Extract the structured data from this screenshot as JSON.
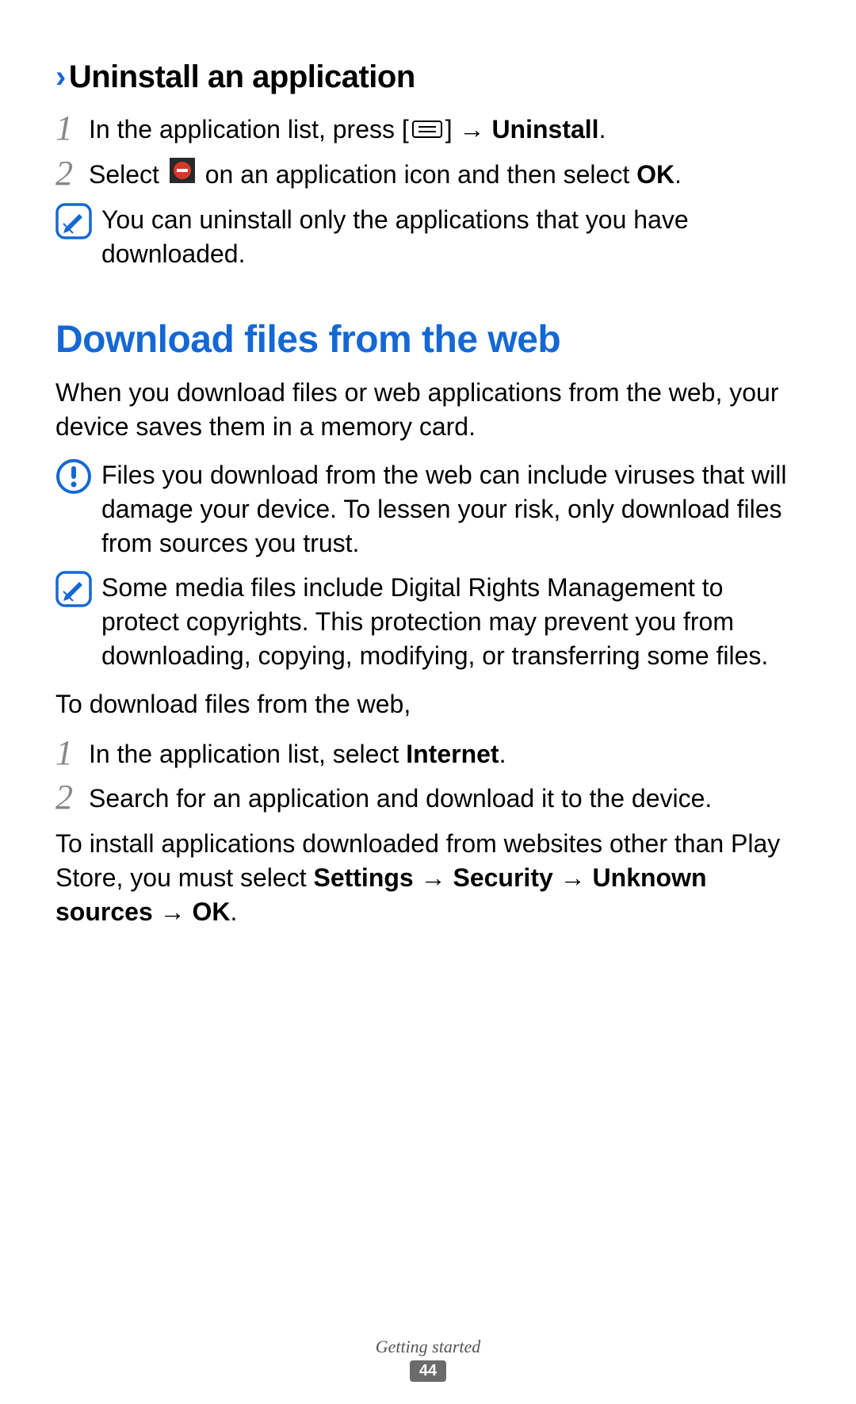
{
  "subsection": {
    "chevron": "›",
    "title": "Uninstall an application"
  },
  "steps1": [
    {
      "num": "1",
      "pre": "In the application list, press [",
      "post": "] → ",
      "bold": "Uninstall",
      "tail": "."
    },
    {
      "num": "2",
      "pre": "Select ",
      "post": " on an application icon and then select ",
      "bold": "OK",
      "tail": "."
    }
  ],
  "note1": "You can uninstall only the applications that you have downloaded.",
  "section_title": "Download files from the web",
  "intro": "When you download files or web applications from the web, your device saves them in a memory card.",
  "warning": "Files you download from the web can include viruses that will damage your device. To lessen your risk, only download files from sources you trust.",
  "note2": "Some media files include Digital Rights Management to protect copyrights. This protection may prevent you from downloading, copying, modifying, or transferring some files.",
  "lead": "To download files from the web,",
  "steps2": [
    {
      "num": "1",
      "pre": "In the application list, select ",
      "bold": "Internet",
      "tail": "."
    },
    {
      "num": "2",
      "plain": "Search for an application and download it to the device."
    }
  ],
  "install_pre": "To install applications downloaded from websites other than Play Store, you must select ",
  "install_bold": "Settings → Security → Unknown sources → OK",
  "install_tail": ".",
  "footer": {
    "label": "Getting started",
    "page": "44"
  }
}
